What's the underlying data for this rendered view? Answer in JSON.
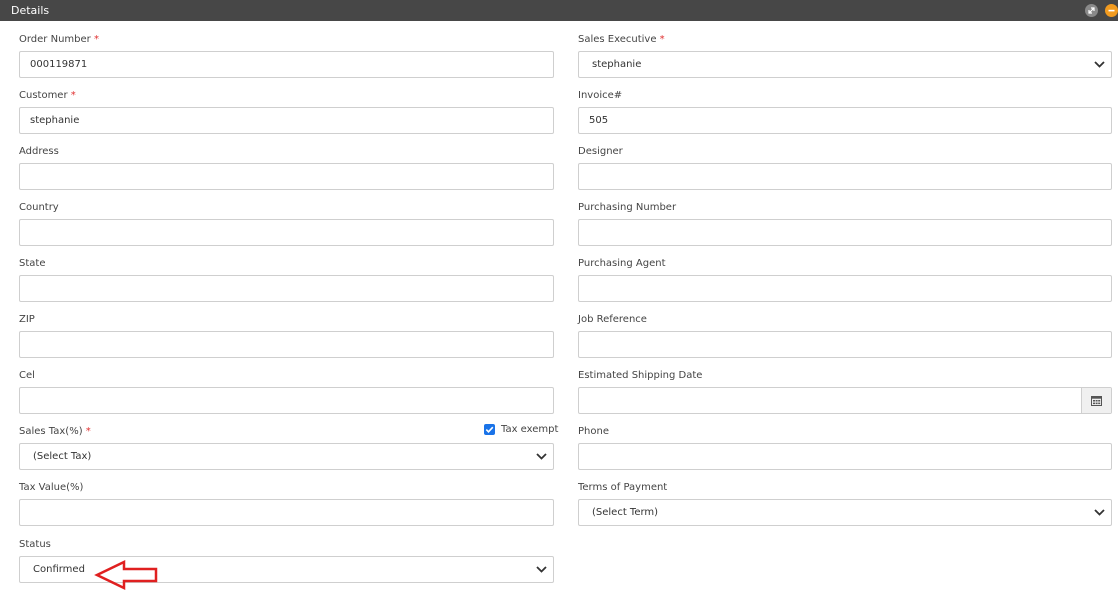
{
  "panel": {
    "title": "Details"
  },
  "required_mark": "*",
  "left": {
    "order_number": {
      "label": "Order Number",
      "value": "000119871"
    },
    "customer": {
      "label": "Customer",
      "value": "stephanie"
    },
    "address": {
      "label": "Address",
      "value": ""
    },
    "country": {
      "label": "Country",
      "value": ""
    },
    "state": {
      "label": "State",
      "value": ""
    },
    "zip": {
      "label": "ZIP",
      "value": ""
    },
    "cel": {
      "label": "Cel",
      "value": ""
    },
    "sales_tax": {
      "label": "Sales Tax(%)",
      "value": "(Select Tax)",
      "tax_exempt_label": "Tax exempt",
      "tax_exempt_checked": true
    },
    "tax_value": {
      "label": "Tax Value(%)",
      "value": ""
    },
    "status": {
      "label": "Status",
      "value": "Confirmed"
    }
  },
  "right": {
    "sales_executive": {
      "label": "Sales Executive",
      "value": "stephanie"
    },
    "invoice": {
      "label": "Invoice#",
      "value": "505"
    },
    "designer": {
      "label": "Designer",
      "value": ""
    },
    "purchasing_number": {
      "label": "Purchasing Number",
      "value": ""
    },
    "purchasing_agent": {
      "label": "Purchasing Agent",
      "value": ""
    },
    "job_reference": {
      "label": "Job Reference",
      "value": ""
    },
    "est_shipping_date": {
      "label": "Estimated Shipping Date",
      "value": ""
    },
    "phone": {
      "label": "Phone",
      "value": ""
    },
    "terms_of_payment": {
      "label": "Terms of Payment",
      "value": "(Select Term)"
    }
  },
  "icons": {
    "expand": "expand-icon",
    "minimize": "minimize-icon",
    "calendar": "calendar-icon",
    "chevron": "chevron-down-icon",
    "annotation": "arrow-left-icon"
  },
  "colors": {
    "header": "#474747",
    "required": "#e03030",
    "checkbox": "#1a73e8",
    "annotation": "#e02020"
  }
}
